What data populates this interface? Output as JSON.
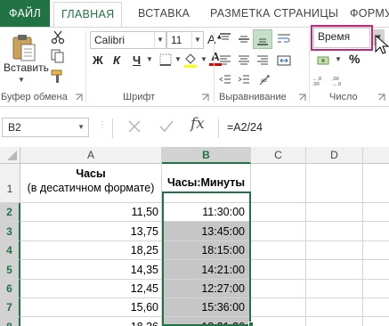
{
  "ribbon": {
    "tabs": [
      {
        "label": "ФАЙЛ"
      },
      {
        "label": "ГЛАВНАЯ"
      },
      {
        "label": "ВСТАВКА"
      },
      {
        "label": "РАЗМЕТКА СТРАНИЦЫ"
      },
      {
        "label": "ФОРМУ"
      }
    ],
    "clipboard": {
      "paste_label": "Вставить",
      "group_label": "Буфер обмена"
    },
    "font": {
      "name": "Calibri",
      "size": "11",
      "bold": "Ж",
      "italic": "К",
      "underline": "Ч",
      "grow": "A",
      "shrink": "A",
      "font_color_glyph": "A",
      "group_label": "Шрифт"
    },
    "alignment": {
      "group_label": "Выравнивание"
    },
    "number": {
      "format": "Время",
      "percent": "%",
      "group_label": "Число"
    }
  },
  "formula_bar": {
    "name_box": "B2",
    "fx": "fx",
    "formula": "=A2/24"
  },
  "sheet": {
    "columns": [
      "A",
      "B",
      "C",
      "D"
    ],
    "rows": [
      "1",
      "2",
      "3",
      "4",
      "5",
      "6",
      "7",
      "8"
    ],
    "header_a_line1": "Часы",
    "header_a_line2": "(в десатичном формате)",
    "header_b": "Часы:Минуты",
    "values_a": [
      "11,50",
      "13,75",
      "18,25",
      "14,35",
      "12,45",
      "15,60",
      "18,36"
    ],
    "values_b": [
      "11:30:00",
      "13:45:00",
      "18:15:00",
      "14:21:00",
      "12:27:00",
      "15:36:00",
      "18:21:36"
    ]
  },
  "colors": {
    "accent": "#217346",
    "highlight_border": "#c0297a",
    "selection_fill": "#c6c6c6"
  }
}
